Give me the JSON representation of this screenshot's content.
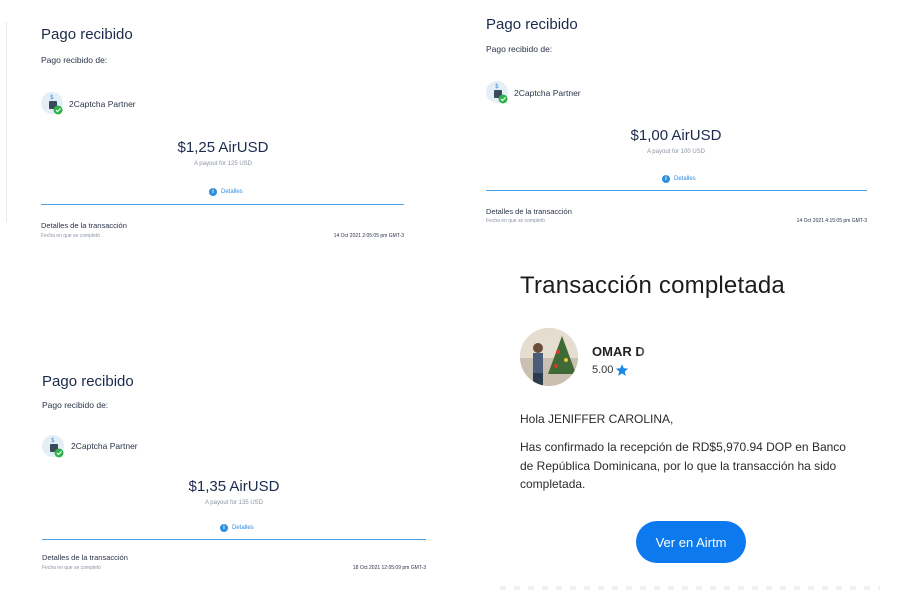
{
  "receipts": [
    {
      "title": "Pago recibido",
      "from_label": "Pago recibido de:",
      "partner": "2Captcha Partner",
      "amount": "$1,25 AirUSD",
      "payout": "A payout for 125 USD",
      "details_link": "Detalles",
      "tx_label": "Detalles de la transacción",
      "tx_sub": "Fecha en que se completó",
      "tx_date": "14 Oct 2021 2:05:05 pm GMT-3"
    },
    {
      "title": "Pago recibido",
      "from_label": "Pago recibido de:",
      "partner": "2Captcha Partner",
      "amount": "$1,00 AirUSD",
      "payout": "A payout for 100 USD",
      "details_link": "Detalles",
      "tx_label": "Detalles de la transacción",
      "tx_sub": "Fecha en que se completó",
      "tx_date": "14 Oct 2021 4:15:05 pm GMT-3"
    },
    {
      "title": "Pago recibido",
      "from_label": "Pago recibido de:",
      "partner": "2Captcha Partner",
      "amount": "$1,35 AirUSD",
      "payout": "A payout for 135 USD",
      "details_link": "Detalles",
      "tx_label": "Detalles de la transacción",
      "tx_sub": "Fecha en que se completó",
      "tx_date": "18 Oct 2021 12:05:09 pm GMT-3"
    }
  ],
  "completion": {
    "title": "Transacción completada",
    "user_name": "OMAR D",
    "rating": "5.00",
    "greeting": "Hola JENIFFER CAROLINA,",
    "message": "Has confirmado la recepción de RD$5,970.94 DOP en Banco de República Dominicana, por lo que la transacción ha sido completada.",
    "button": "Ver en Airtm"
  },
  "colors": {
    "accent": "#0c79ef",
    "link": "#2d8fe0",
    "check": "#2fb24c",
    "star": "#1e88e5"
  },
  "icons": [
    "airtm-logo-icon",
    "check-icon",
    "info-icon",
    "star-icon"
  ]
}
